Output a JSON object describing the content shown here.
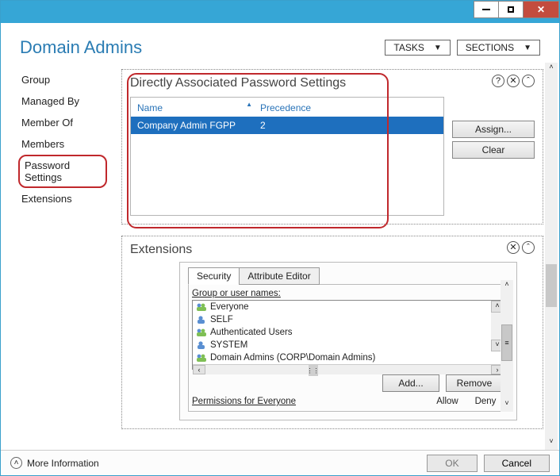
{
  "page_title": "Domain Admins",
  "top_buttons": {
    "tasks": "TASKS",
    "sections": "SECTIONS"
  },
  "sidebar": {
    "items": [
      {
        "label": "Group"
      },
      {
        "label": "Managed By"
      },
      {
        "label": "Member Of"
      },
      {
        "label": "Members"
      },
      {
        "label": "Password Settings",
        "active": true
      },
      {
        "label": "Extensions"
      }
    ]
  },
  "pwsection": {
    "title": "Directly Associated Password Settings",
    "columns": {
      "name": "Name",
      "precedence": "Precedence"
    },
    "rows": [
      {
        "name": "Company Admin FGPP",
        "precedence": "2"
      }
    ],
    "assign": "Assign...",
    "clear": "Clear"
  },
  "extsection": {
    "title": "Extensions",
    "tabs": {
      "security": "Security",
      "attribute": "Attribute Editor"
    },
    "group_label": "Group or user names:",
    "principals": [
      "Everyone",
      "SELF",
      "Authenticated Users",
      "SYSTEM",
      "Domain Admins (CORP\\Domain Admins)"
    ],
    "add": "Add...",
    "remove": "Remove",
    "perm_label": "Permissions for Everyone",
    "allow": "Allow",
    "deny": "Deny"
  },
  "footer": {
    "moreinfo": "More Information",
    "ok": "OK",
    "cancel": "Cancel"
  }
}
